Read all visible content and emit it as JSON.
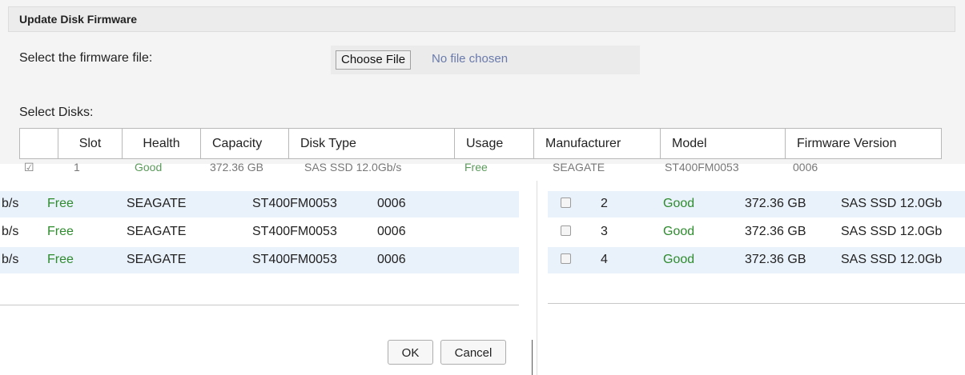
{
  "dialog": {
    "title": "Update Disk Firmware",
    "firmware_label": "Select the firmware file:",
    "choose_file_label": "Choose File",
    "no_file_text": "No file chosen",
    "select_disks_label": "Select Disks:"
  },
  "table": {
    "headers": [
      "Slot",
      "Health",
      "Capacity",
      "Disk Type",
      "Usage",
      "Manufacturer",
      "Model",
      "Firmware Version"
    ]
  },
  "left_rows": [
    {
      "type_tail": "b/s",
      "usage": "Free",
      "manufacturer": "SEAGATE",
      "model": "ST400FM0053",
      "firmware": "0006"
    },
    {
      "type_tail": "b/s",
      "usage": "Free",
      "manufacturer": "SEAGATE",
      "model": "ST400FM0053",
      "firmware": "0006"
    },
    {
      "type_tail": "b/s",
      "usage": "Free",
      "manufacturer": "SEAGATE",
      "model": "ST400FM0053",
      "firmware": "0006"
    }
  ],
  "right_rows": [
    {
      "slot": "2",
      "health": "Good",
      "capacity": "372.36 GB",
      "disk_type": "SAS SSD 12.0Gb"
    },
    {
      "slot": "3",
      "health": "Good",
      "capacity": "372.36 GB",
      "disk_type": "SAS SSD 12.0Gb"
    },
    {
      "slot": "4",
      "health": "Good",
      "capacity": "372.36 GB",
      "disk_type": "SAS SSD 12.0Gb"
    }
  ],
  "garbled_row": {
    "slot": "1",
    "health": "Good",
    "capacity": "372.36 GB",
    "disk_type": "SAS SSD 12.0Gb/s",
    "usage": "Free",
    "manufacturer": "SEAGATE",
    "model": "ST400FM0053",
    "firmware": "0006"
  },
  "buttons": {
    "ok": "OK",
    "cancel": "Cancel"
  },
  "colors": {
    "good_green": "#2e8b2e",
    "row_shade": "#e9f1fb",
    "panel_bg": "#f4f4f4"
  }
}
